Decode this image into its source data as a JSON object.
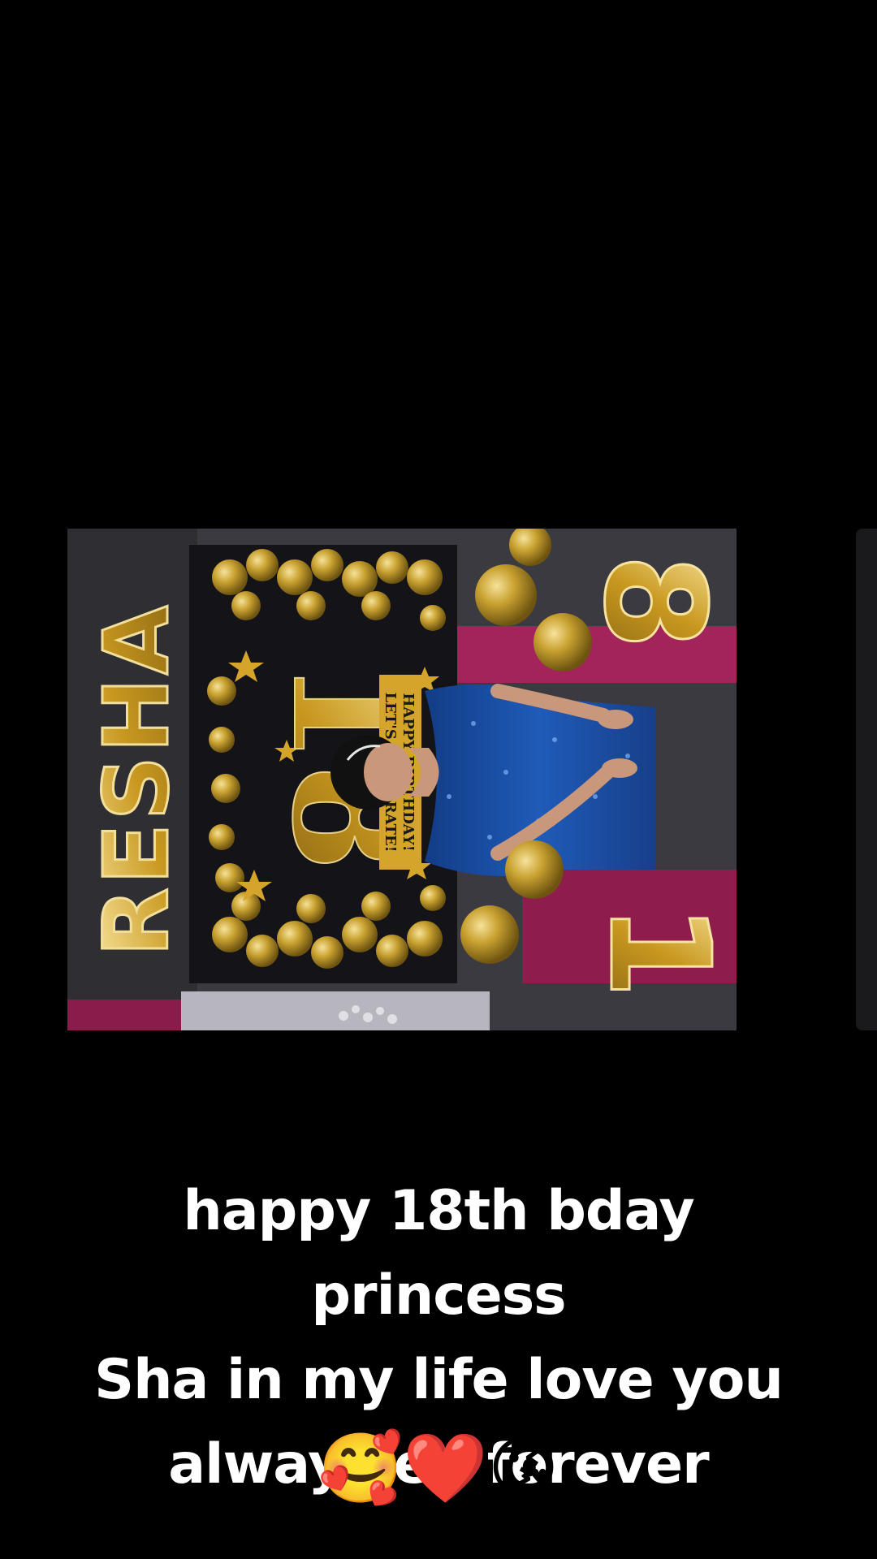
{
  "post": {
    "caption_lines": [
      "happy 18th bday princess",
      "Sha in my life love you",
      "always en forever"
    ],
    "emojis": [
      "🥰",
      "❤️",
      "😘"
    ]
  },
  "photo": {
    "balloon_letters": "RESHA",
    "backdrop_number": "18",
    "backdrop_text_1": "HAPPY BIRTHDAY!",
    "backdrop_text_2": "LET'S CELEBRATE!",
    "number_balloon_top": "8",
    "number_balloon_bottom": "1",
    "colors": {
      "gold": "#d4a52a",
      "dress": "#1a4fa3",
      "pink": "#a3235b",
      "backdrop": "#141418"
    }
  }
}
